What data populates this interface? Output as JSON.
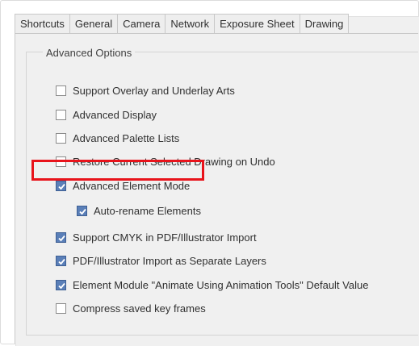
{
  "tabs": [
    {
      "label": "Shortcuts",
      "active": false
    },
    {
      "label": "General",
      "active": false
    },
    {
      "label": "Camera",
      "active": false
    },
    {
      "label": "Network",
      "active": false
    },
    {
      "label": "Exposure Sheet",
      "active": false
    },
    {
      "label": "Drawing",
      "active": true
    }
  ],
  "group": {
    "title": "Advanced Options"
  },
  "options": [
    {
      "label": "Support Overlay and Underlay Arts",
      "checked": false
    },
    {
      "label": "Advanced Display",
      "checked": false
    },
    {
      "label": "Advanced Palette Lists",
      "checked": false
    },
    {
      "label": "Restore Current Selected Drawing on Undo",
      "checked": false
    },
    {
      "label": "Advanced Element Mode",
      "checked": true
    },
    {
      "label": "Auto-rename Elements",
      "checked": true
    },
    {
      "label": "Support CMYK in PDF/Illustrator Import",
      "checked": true
    },
    {
      "label": "PDF/Illustrator Import as Separate Layers",
      "checked": true
    },
    {
      "label": "Element Module \"Animate Using Animation Tools\" Default Value",
      "checked": true
    },
    {
      "label": "Compress saved key frames",
      "checked": false
    }
  ],
  "colors": {
    "highlight": "#e8131b",
    "checkbox_checked": "#5a7fb8"
  }
}
